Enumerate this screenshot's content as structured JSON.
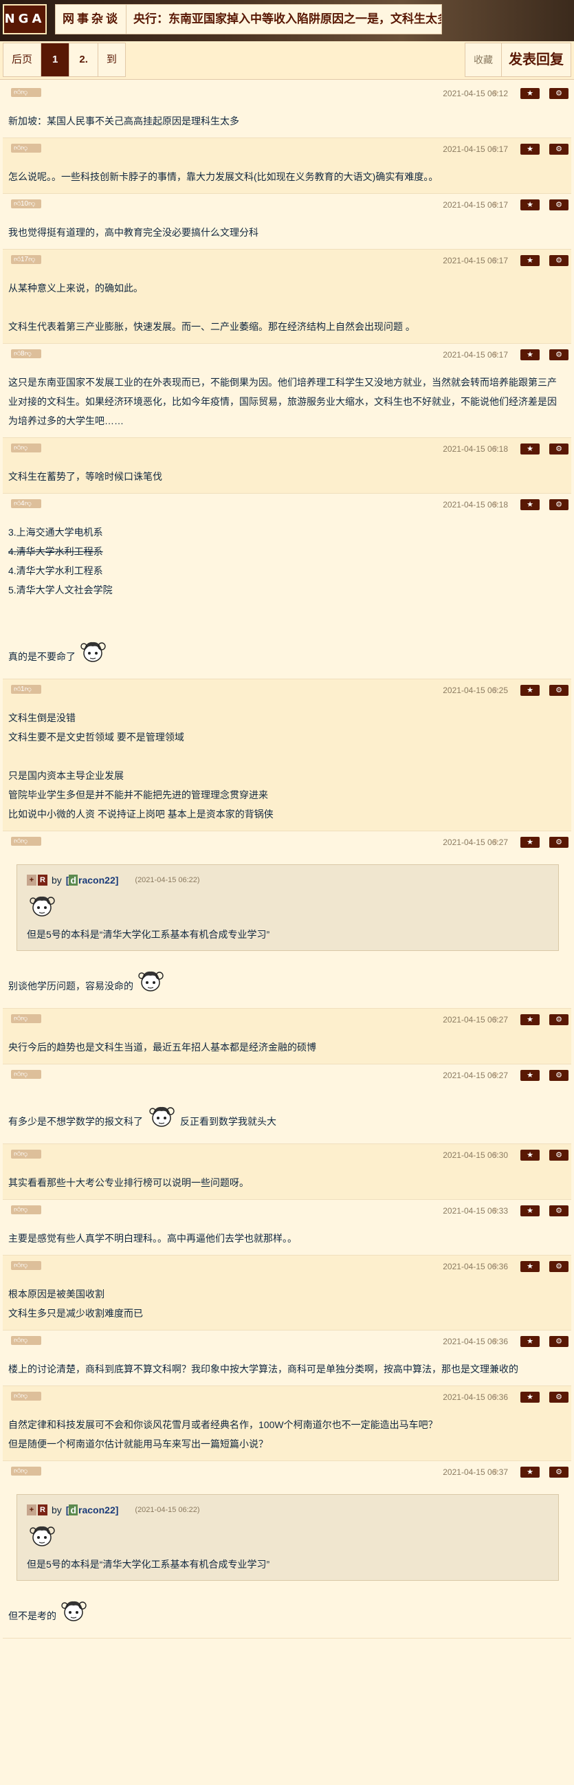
{
  "header": {
    "logo": "NGA",
    "forum": "网事杂谈",
    "title": "央行：东南亚国家掉入中等收入陷阱原因之一是，文科生太多"
  },
  "pager": {
    "prev": "后页",
    "page1": "1",
    "page2": "2.",
    "goto": "到"
  },
  "actions": {
    "favorite": "收藏",
    "reply": "发表回复"
  },
  "icons": {
    "like": "thumbs-up-icon",
    "dislike": "thumbs-down-icon",
    "star": "star-icon",
    "gear": "gear-icon"
  },
  "posts": [
    {
      "votes": "",
      "time": "2021-04-15 06:12",
      "lines": [
        "新加坡：某国人民事不关己高高挂起原因是理科生太多"
      ]
    },
    {
      "votes": "",
      "time": "2021-04-15 06:17",
      "lines": [
        "怎么说呢。。一些科技创新卡脖子的事情，靠大力发展文科(比如现在义务教育的大语文)确实有难度。。"
      ]
    },
    {
      "votes": "10",
      "time": "2021-04-15 06:17",
      "lines": [
        "我也觉得挺有道理的，高中教育完全没必要搞什么文理分科"
      ]
    },
    {
      "votes": "17",
      "time": "2021-04-15 06:17",
      "lines": [
        "从某种意义上来说，的确如此。",
        "",
        "文科生代表着第三产业膨胀，快速发展。而一、二产业萎缩。那在经济结构上自然会出现问题 。"
      ]
    },
    {
      "votes": "8",
      "time": "2021-04-15 06:17",
      "lines": [
        "这只是东南亚国家不发展工业的在外表现而已，不能倒果为因。他们培养理工科学生又没地方就业，当然就会转而培养能跟第三产业对接的文科生。如果经济环境恶化，比如今年疫情，国际贸易，旅游服务业大缩水，文科生也不好就业，不能说他们经济差是因为培养过多的大学生吧……"
      ]
    },
    {
      "votes": "",
      "time": "2021-04-15 06:18",
      "lines": [
        "文科生在蓄势了，等啥时候口诛笔伐"
      ]
    },
    {
      "votes": "4",
      "time": "2021-04-15 06:18",
      "lines": [
        "3.上海交通大学电机系",
        "4.清华大学水利工程系",
        "4.清华大学水利工程系",
        "5.清华大学人文社会学院",
        "",
        "",
        "真的是不要命了"
      ]
    },
    {
      "votes": "1",
      "time": "2021-04-15 06:25",
      "lines": [
        "文科生倒是没错",
        "文科生要不是文史哲领域 要不是管理领域",
        "",
        "只是国内资本主导企业发展",
        "管院毕业学生多但是并不能并不能把先进的管理理念贯穿进来",
        "比如说中小微的人资 不说持证上岗吧 基本上是资本家的背锅侠"
      ]
    },
    {
      "votes": "",
      "time": "2021-04-15 06:27",
      "quote": {
        "user_initial": "d",
        "user_rest": "racon22",
        "by": "by",
        "time": "(2021-04-15 06:22)",
        "text": "但是5号的本科是“清华大学化工系基本有机合成专业学习”"
      },
      "lines": [
        "别谈他学历问题，容易没命的"
      ]
    },
    {
      "votes": "",
      "time": "2021-04-15 06:27",
      "lines": [
        "央行今后的趋势也是文科生当道，最近五年招人基本都是经济金融的硕博"
      ]
    },
    {
      "votes": "",
      "time": "2021-04-15 06:27",
      "lines": [
        "有多少是不想学数学的报文科了",
        "反正看到数学我就头大"
      ]
    },
    {
      "votes": "",
      "time": "2021-04-15 06:30",
      "lines": [
        "其实看看那些十大考公专业排行榜可以说明一些问题呀。"
      ]
    },
    {
      "votes": "",
      "time": "2021-04-15 06:33",
      "lines": [
        "主要是感觉有些人真学不明白理科。。高中再逼他们去学也就那样。。"
      ]
    },
    {
      "votes": "",
      "time": "2021-04-15 06:36",
      "lines": [
        "根本原因是被美国收割",
        "文科生多只是减少收割难度而已"
      ]
    },
    {
      "votes": "",
      "time": "2021-04-15 06:36",
      "lines": [
        "楼上的讨论清楚，商科到底算不算文科啊？我印象中按大学算法，商科可是单独分类啊，按高中算法，那也是文理兼收的"
      ]
    },
    {
      "votes": "",
      "time": "2021-04-15 06:36",
      "lines": [
        "自然定律和科技发展可不会和你谈风花雪月或者经典名作，100W个柯南道尔也不一定能造出马车吧？",
        "但是随便一个柯南道尔估计就能用马车来写出一篇短篇小说？"
      ]
    },
    {
      "votes": "",
      "time": "2021-04-15 06:37",
      "quote": {
        "user_initial": "d",
        "user_rest": "racon22",
        "by": "by",
        "time": "(2021-04-15 06:22)",
        "text": "但是5号的本科是“清华大学化工系基本有机合成专业学习”"
      },
      "lines": [
        "但不是考的"
      ]
    }
  ]
}
